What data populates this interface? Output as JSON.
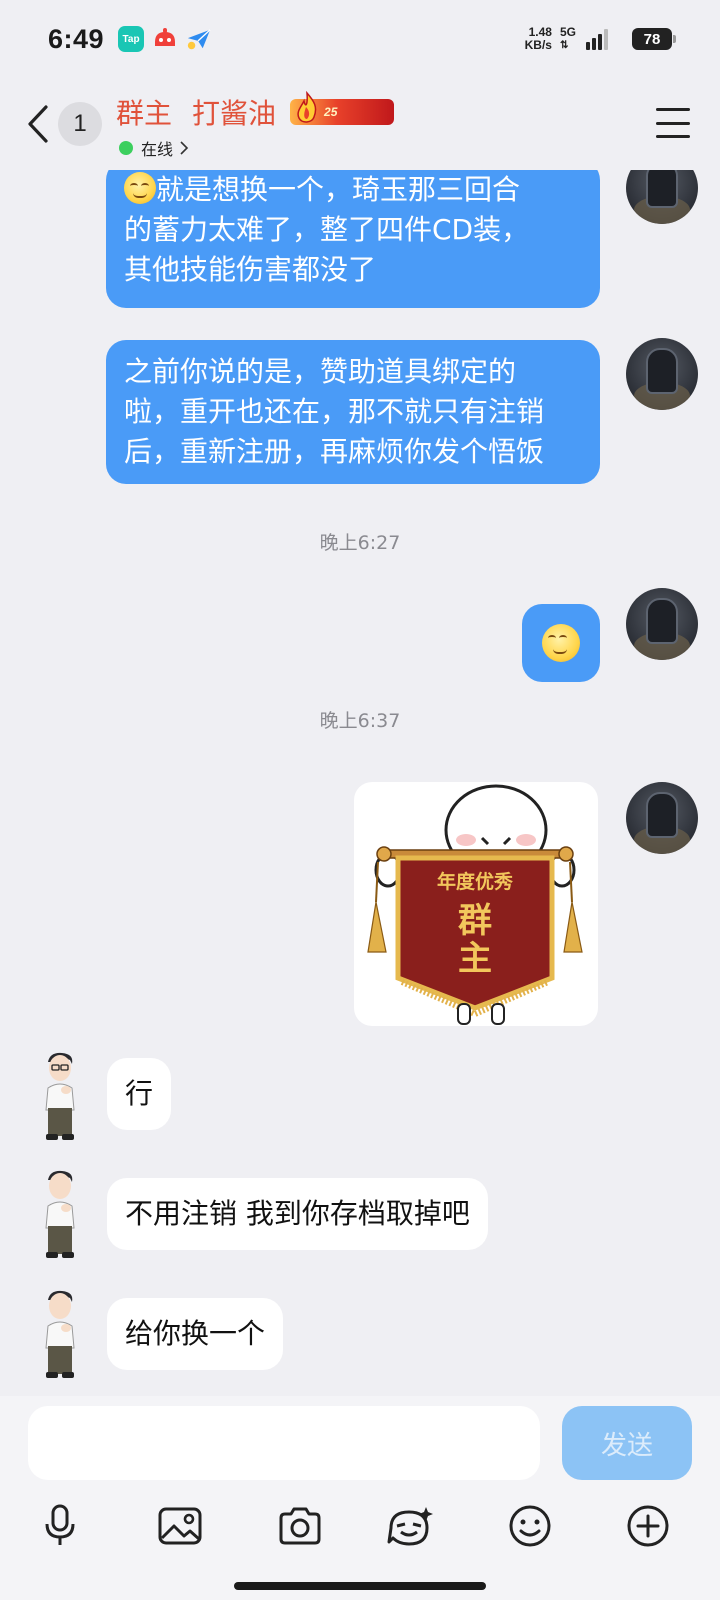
{
  "status_bar": {
    "time": "6:49",
    "apps": [
      "Tap",
      "red-app",
      "plane-app"
    ],
    "net_speed_value": "1.48",
    "net_speed_unit": "KB/s",
    "network_type": "5G",
    "battery": "78"
  },
  "header": {
    "back_icon": "chevron-left-icon",
    "unread_count": "1",
    "group_role": "群主",
    "contact_name": "打酱油",
    "level_badge_text": "25",
    "online_status": "在线",
    "menu_icon": "menu-icon"
  },
  "messages": {
    "msg1": {
      "line1_suffix": "就是想换一个，琦玉那三回合",
      "line2": "的蓄力太难了，整了四件CD装，",
      "line3": "其他技能伤害都没了"
    },
    "msg2": {
      "line1": "之前你说的是，赞助道具绑定的",
      "line2": "啦，重开也还在，那不就只有注销",
      "line3": "后，重新注册，再麻烦你发个悟饭"
    },
    "time1": "晚上6:27",
    "time2": "晚上6:37",
    "sticker": {
      "banner_top": "年度优秀",
      "banner_main_1": "群",
      "banner_main_2": "主"
    },
    "reply1": "行",
    "reply2": "不用注销 我到你存档取掉吧",
    "reply3": "给你换一个"
  },
  "input": {
    "value": "",
    "send_label": "发送"
  },
  "toolbar": {
    "icons": [
      "microphone-icon",
      "image-icon",
      "camera-icon",
      "sticker-face-icon",
      "emoji-icon",
      "plus-icon"
    ]
  },
  "colors": {
    "accent_blue": "#4a9bf7",
    "title_red": "#e0523a",
    "online_green": "#3ccf5e",
    "send_disabled": "#8cc3f5"
  }
}
